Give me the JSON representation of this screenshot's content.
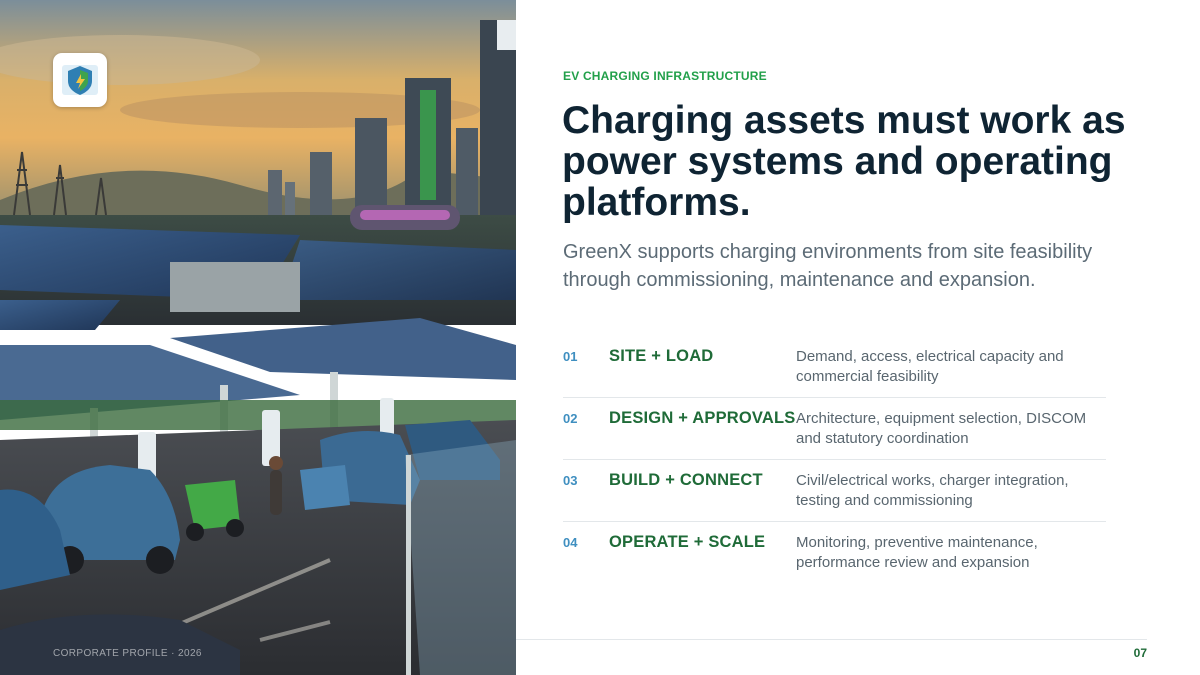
{
  "photo": {
    "description_icon": "ev-charging-solar-city-photo",
    "footer_label": "CORPORATE PROFILE · 2026"
  },
  "logo": {
    "icon": "greenx-shield-logo-icon"
  },
  "header": {
    "eyebrow": "EV CHARGING INFRASTRUCTURE",
    "headline": "Charging assets must work as power systems and operating platforms.",
    "subtitle": "GreenX supports charging environments from site feasibility through commissioning, maintenance and expansion."
  },
  "steps": [
    {
      "num": "01",
      "title": "SITE + LOAD",
      "desc": "Demand, access, electrical capacity and commercial feasibility"
    },
    {
      "num": "02",
      "title": "DESIGN + APPROVALS",
      "desc": "Architecture, equipment selection, DISCOM and statutory coordination"
    },
    {
      "num": "03",
      "title": "BUILD + CONNECT",
      "desc": "Civil/electrical works, charger integration, testing and commissioning"
    },
    {
      "num": "04",
      "title": "OPERATE + SCALE",
      "desc": "Monitoring, preventive maintenance, performance review and expansion"
    }
  ],
  "footer": {
    "page_number": "07"
  },
  "colors": {
    "accent_green": "#22a04a",
    "title_green": "#1f6b38",
    "number_blue": "#3f8fc0",
    "headline": "#0f2433"
  }
}
